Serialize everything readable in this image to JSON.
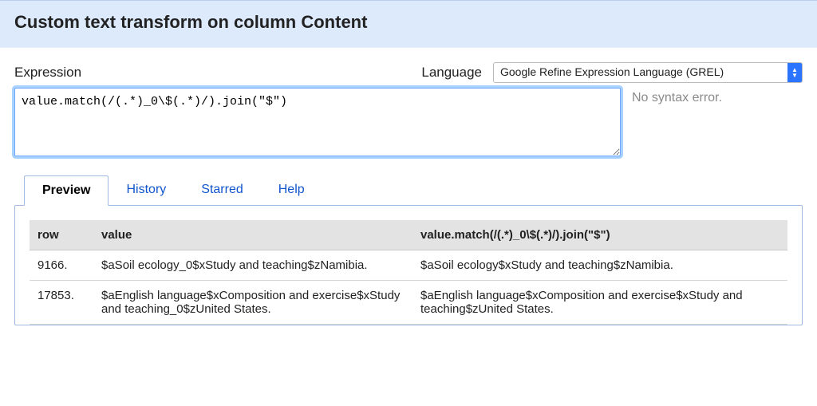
{
  "dialog": {
    "title": "Custom text transform on column Content",
    "expression_label": "Expression",
    "language_label": "Language",
    "language_selected": "Google Refine Expression Language (GREL)",
    "expression_value": "value.match(/(.*)_0\\$(.*)/).join(\"$\")",
    "status_text": "No syntax error."
  },
  "tabs": [
    {
      "key": "preview",
      "label": "Preview",
      "active": true
    },
    {
      "key": "history",
      "label": "History",
      "active": false
    },
    {
      "key": "starred",
      "label": "Starred",
      "active": false
    },
    {
      "key": "help",
      "label": "Help",
      "active": false
    }
  ],
  "preview": {
    "headers": {
      "row": "row",
      "value": "value",
      "result": "value.match(/(.*)_0\\$(.*)/).join(\"$\")"
    },
    "rows": [
      {
        "row": "9166.",
        "value": "$aSoil ecology_0$xStudy and teaching$zNamibia.",
        "result": "$aSoil ecology$xStudy and teaching$zNamibia."
      },
      {
        "row": "17853.",
        "value": "$aEnglish language$xComposition and exercise$xStudy and teaching_0$zUnited States.",
        "result": "$aEnglish language$xComposition and exercise$xStudy and teaching$zUnited States."
      }
    ]
  }
}
